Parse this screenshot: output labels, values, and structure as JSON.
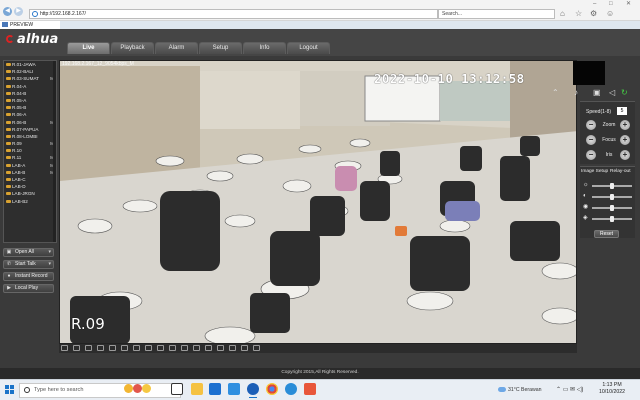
{
  "browser": {
    "url": "http://192.168.2.167/",
    "search_placeholder": "Search...",
    "tab_title": "PREVIEW"
  },
  "header": {
    "logo": "alhua",
    "tabs": [
      "Live",
      "Playback",
      "Alarm",
      "Setup",
      "Info",
      "Logout"
    ],
    "active_tab": "Live"
  },
  "channels": {
    "items": [
      {
        "label": "R.01-JAWA",
        "m": ""
      },
      {
        "label": "R.02-BALI",
        "m": ""
      },
      {
        "label": "R.03-SUMAT",
        "m": "M"
      },
      {
        "label": "R.04-A",
        "m": ""
      },
      {
        "label": "R.04-B",
        "m": ""
      },
      {
        "label": "R.05-A",
        "m": ""
      },
      {
        "label": "R.05-B",
        "m": ""
      },
      {
        "label": "R.06-A",
        "m": ""
      },
      {
        "label": "R.06-B",
        "m": "M"
      },
      {
        "label": "R.07-PAPUA",
        "m": ""
      },
      {
        "label": "R.08-LOMBI",
        "m": ""
      },
      {
        "label": "R.09",
        "m": "M"
      },
      {
        "label": "R.10",
        "m": ""
      },
      {
        "label": "R.11",
        "m": "M"
      },
      {
        "label": "LAB-A",
        "m": "M"
      },
      {
        "label": "LAB-B",
        "m": "M"
      },
      {
        "label": "LAB-C",
        "m": ""
      },
      {
        "label": "LAB-D",
        "m": ""
      },
      {
        "label": "LAB-JRGN",
        "m": ""
      },
      {
        "label": "LAB-B2",
        "m": ""
      }
    ],
    "buttons": {
      "open_all": "Open All",
      "start_talk": "Start Talk",
      "instant_record": "Instant Record",
      "local_play": "Local Play"
    }
  },
  "video": {
    "stream_info": "192.168.2.167_12_9054kbps_M",
    "osd_time": "2022-10-10 13:12:58",
    "osd_name": "R.09"
  },
  "ptz": {
    "speed_label": "Speed(1-8)",
    "speed_value": "5",
    "zoom_label": "Zoom",
    "focus_label": "Focus",
    "iris_label": "Iris"
  },
  "image_setup": {
    "tab1": "Image Setup",
    "tab2": "Relay-out",
    "reset_label": "Reset",
    "slider_levels": [
      0.5,
      0.5,
      0.5,
      0.5
    ]
  },
  "footer": {
    "copyright": "Copyright 2015,All Rights Reserved."
  },
  "taskbar": {
    "search_placeholder": "Type here to search",
    "weather": "31°C  Berawan",
    "time": "1:13 PM",
    "date": "10/10/2022"
  }
}
